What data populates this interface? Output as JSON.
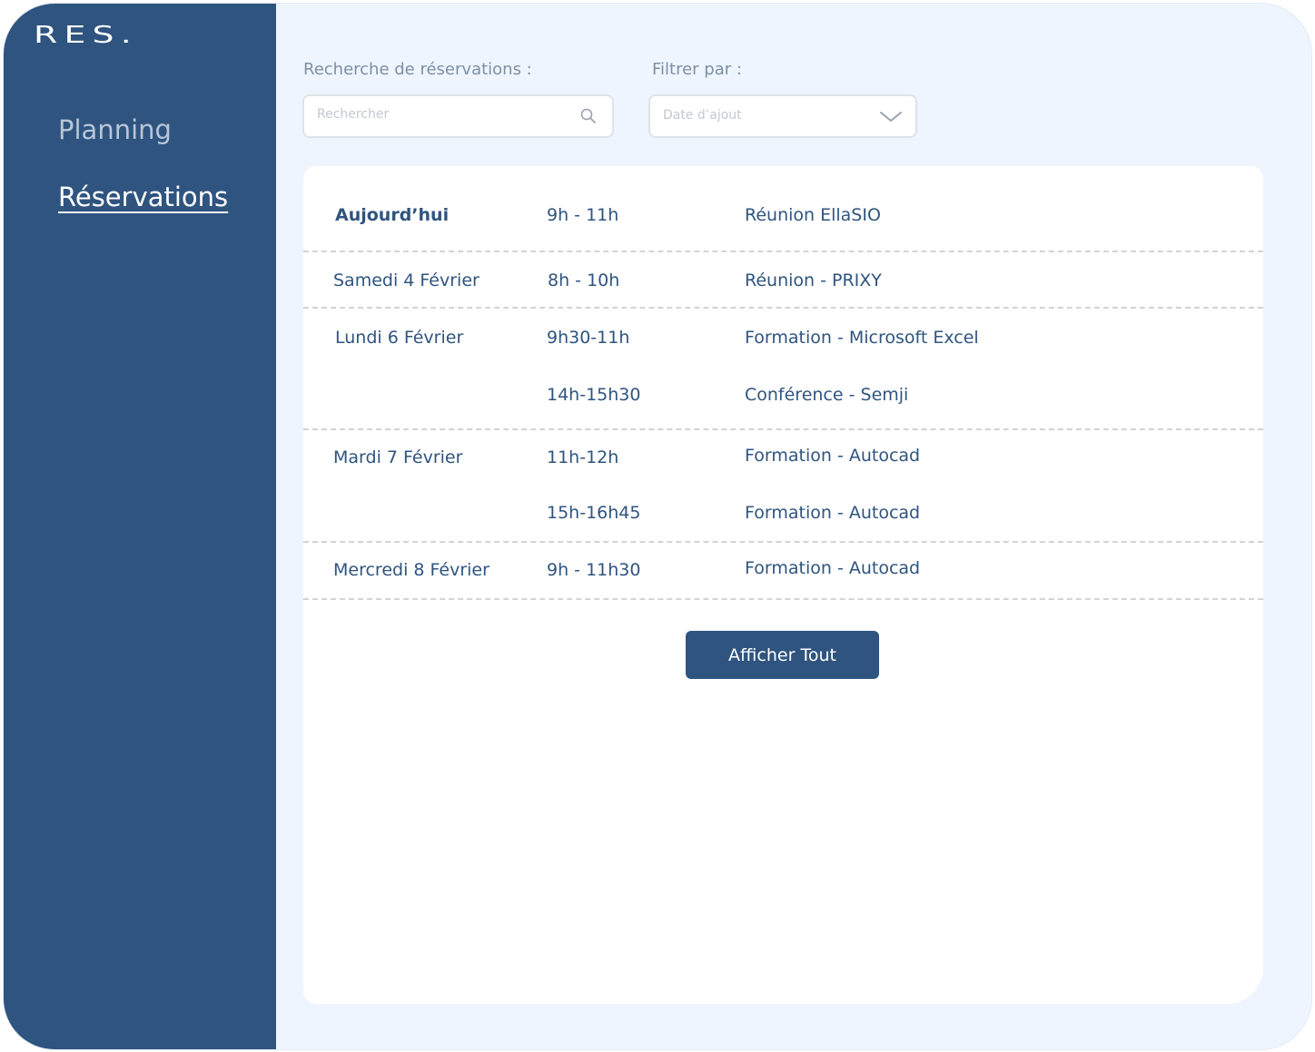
{
  "app": {
    "logo": "RES."
  },
  "sidebar": {
    "items": [
      {
        "label": "Planning",
        "active": false
      },
      {
        "label": "Réservations",
        "active": true
      }
    ]
  },
  "search": {
    "label": "Recherche de réservations :",
    "placeholder": "Rechercher",
    "value": "",
    "icon": "search-icon"
  },
  "filter": {
    "label": "Filtrer par :",
    "selected": "Date d’ajout",
    "icon": "chevron-down-icon"
  },
  "reservations": [
    {
      "date": "Aujourd’hui",
      "entries": [
        {
          "time": "9h - 11h",
          "title": "Réunion EllaSIO"
        }
      ]
    },
    {
      "date": "Samedi 4 Février",
      "entries": [
        {
          "time": "8h - 10h",
          "title": "Réunion - PRIXY"
        }
      ]
    },
    {
      "date": "Lundi 6 Février",
      "entries": [
        {
          "time": "9h30-11h",
          "title": "Formation - Microsoft Excel"
        },
        {
          "time": "14h-15h30",
          "title": "Conférence - Semji"
        }
      ]
    },
    {
      "date": "Mardi 7 Février",
      "entries": [
        {
          "time": "11h-12h",
          "title": "Formation - Autocad"
        },
        {
          "time": "15h-16h45",
          "title": "Formation - Autocad"
        }
      ]
    },
    {
      "date": "Mercredi 8 Février",
      "entries": [
        {
          "time": "9h - 11h30",
          "title": "Formation - Autocad"
        }
      ]
    }
  ],
  "actions": {
    "show_all_label": "Afficher Tout"
  },
  "colors": {
    "sidebar": "#2f547f",
    "background": "#eef5fe",
    "text": "#2f547f",
    "muted": "#7d8fa5"
  }
}
